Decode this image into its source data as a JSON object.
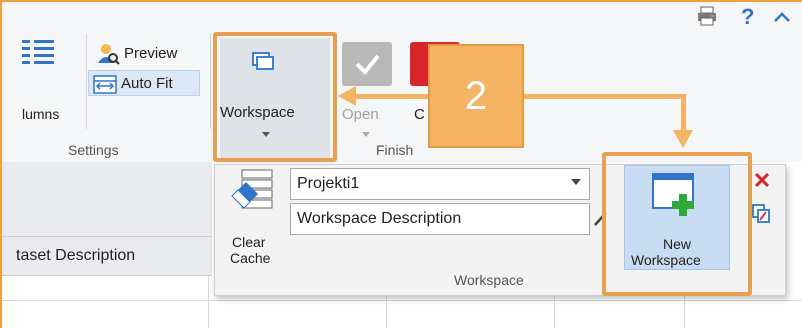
{
  "ribbon": {
    "settings_group": {
      "columns_label": "lumns",
      "preview_label": "Preview",
      "autofit_label": "Auto Fit",
      "group_label": "Settings"
    },
    "finish_group": {
      "workspace_label": "Workspace",
      "open_label": "Open",
      "close_label_partial": "C",
      "group_label": "Finish"
    },
    "system_icons": [
      "printer-icon",
      "help-icon",
      "collapse-icon"
    ]
  },
  "workspace_panel": {
    "clear_cache_line1": "Clear",
    "clear_cache_line2": "Cache",
    "project_value": "Projekti1",
    "description_value": "Workspace Description",
    "new_workspace_line1": "New",
    "new_workspace_line2": "Workspace",
    "group_label": "Workspace"
  },
  "grid": {
    "column_header": "taset Description"
  },
  "annotation": {
    "step_number": "2",
    "color": "#f4b463",
    "border_color": "#e8a050"
  },
  "colors": {
    "ribbon_bg": "#f5f6f7",
    "selected_bg": "#c8dcf3",
    "close_red": "#d9262c",
    "open_grey": "#b8b8b8",
    "add_green": "#2fa83a"
  }
}
